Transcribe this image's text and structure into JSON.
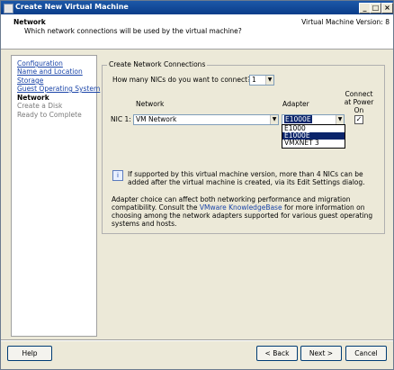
{
  "window": {
    "title": "Create New Virtual Machine"
  },
  "header": {
    "title": "Network",
    "subtitle": "Which network connections will be used by the virtual machine?",
    "version": "Virtual Machine Version: 8"
  },
  "nav": {
    "items": [
      {
        "label": "Configuration"
      },
      {
        "label": "Name and Location"
      },
      {
        "label": "Storage"
      },
      {
        "label": "Guest Operating System"
      },
      {
        "label": "Network"
      },
      {
        "label": "Create a Disk"
      },
      {
        "label": "Ready to Complete"
      }
    ]
  },
  "main": {
    "group_label": "Create Network Connections",
    "nic_count_question": "How many NICs do you want to connect?",
    "nic_count_value": "1",
    "col_network": "Network",
    "col_adapter": "Adapter",
    "col_connect": "Connect at Power On",
    "nic_label": "NIC 1:",
    "network_value": "VM Network",
    "adapter_value": "E1000E",
    "adapter_options": [
      "E1000",
      "E1000E",
      "VMXNET 3"
    ],
    "info_text": "If supported by this virtual machine version, more than 4 NICs can be added after the virtual machine is created, via its Edit Settings dialog.",
    "advice_pre": "Adapter choice can affect both networking performance and migration compatibility. Consult the ",
    "advice_link": "VMware KnowledgeBase",
    "advice_post": " for more information on choosing among the network adapters supported for various guest operating systems and hosts."
  },
  "footer": {
    "help": "Help",
    "back": "< Back",
    "next": "Next >",
    "cancel": "Cancel"
  }
}
